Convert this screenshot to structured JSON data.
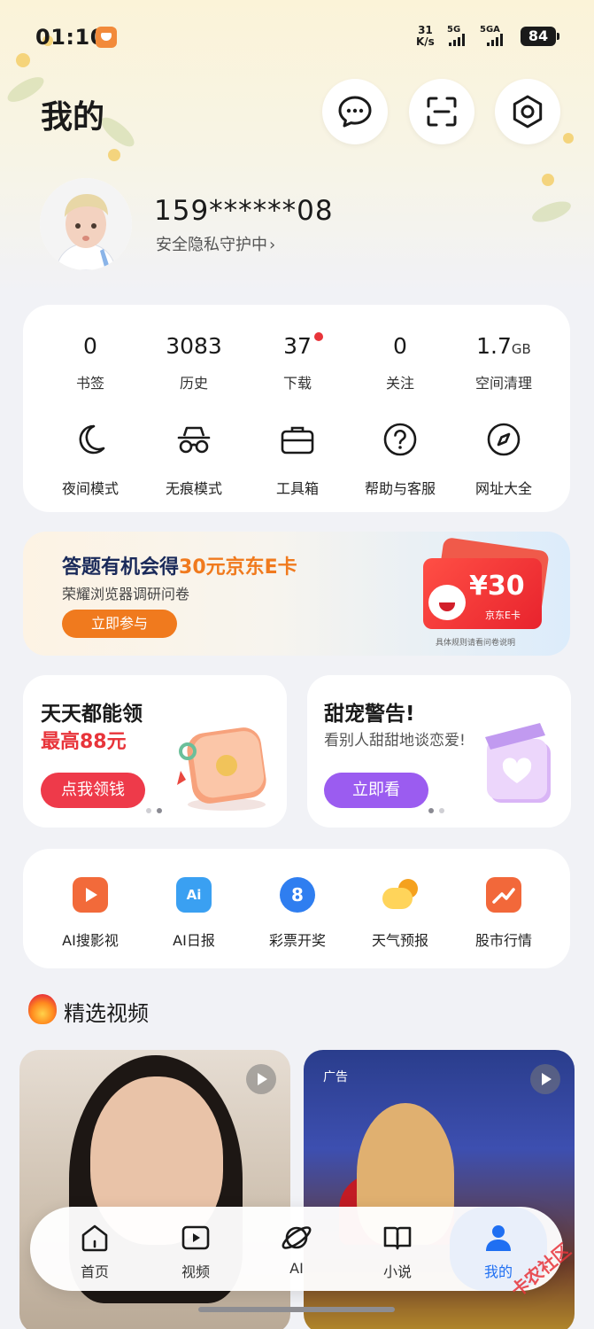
{
  "status_bar": {
    "time": "01:10",
    "net_speed_top": "31",
    "net_speed_bottom": "K/s",
    "sig1": "5G",
    "sig2": "5GA",
    "battery": "84"
  },
  "header": {
    "title": "我的"
  },
  "profile": {
    "phone": "159******08",
    "privacy": "安全隐私守护中"
  },
  "stats": [
    {
      "value": "0",
      "unit": "",
      "label": "书签"
    },
    {
      "value": "3083",
      "unit": "",
      "label": "历史"
    },
    {
      "value": "37",
      "unit": "",
      "label": "下载"
    },
    {
      "value": "0",
      "unit": "",
      "label": "关注"
    },
    {
      "value": "1.7",
      "unit": "GB",
      "label": "空间清理"
    }
  ],
  "tools": [
    {
      "label": "夜间模式",
      "icon": "moon-icon"
    },
    {
      "label": "无痕模式",
      "icon": "incognito-icon"
    },
    {
      "label": "工具箱",
      "icon": "toolbox-icon"
    },
    {
      "label": "帮助与客服",
      "icon": "help-icon"
    },
    {
      "label": "网址大全",
      "icon": "compass-icon"
    }
  ],
  "quiz_banner": {
    "title_prefix": "答题有机会得",
    "title_highlight": "30元京东E卡",
    "subtitle": "荣耀浏览器调研问卷",
    "button": "立即参与",
    "card_amount": "¥30",
    "card_label": "京东E卡",
    "note": "具体规则请看问卷说明"
  },
  "promo_left": {
    "title": "天天都能领",
    "subtitle": "最高88元",
    "button": "点我领钱"
  },
  "promo_right": {
    "title": "甜宠警告!",
    "subtitle": "看别人甜甜地谈恋爱!",
    "button": "立即看"
  },
  "services": [
    {
      "label": "AI搜影视",
      "icon": "ai-video-icon",
      "color": "#f26a3a"
    },
    {
      "label": "AI日报",
      "icon": "ai-daily-icon",
      "color": "#3aa0f2"
    },
    {
      "label": "彩票开奖",
      "icon": "lottery-icon",
      "color": "#2f7ef0"
    },
    {
      "label": "天气预报",
      "icon": "weather-icon",
      "color": "#f5b42a"
    },
    {
      "label": "股市行情",
      "icon": "stock-icon",
      "color": "#f2683a"
    }
  ],
  "section": {
    "title": "精选视频"
  },
  "videos": [
    {
      "ad": ""
    },
    {
      "ad": "广告"
    }
  ],
  "nav": [
    {
      "label": "首页",
      "icon": "home-icon"
    },
    {
      "label": "视频",
      "icon": "video-icon"
    },
    {
      "label": "AI",
      "icon": "ai-planet-icon"
    },
    {
      "label": "小说",
      "icon": "novel-icon"
    },
    {
      "label": "我的",
      "icon": "profile-icon"
    }
  ],
  "watermark": "卡农社区",
  "colors": {
    "accent": "#1f6ff2",
    "orange": "#f07a1e",
    "red": "#e8343a",
    "purple": "#9b5cf0"
  }
}
